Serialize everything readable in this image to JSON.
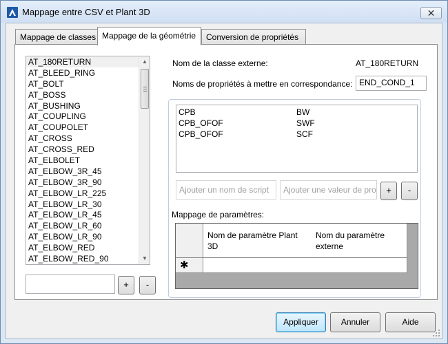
{
  "window": {
    "title": "Mappage entre CSV et Plant 3D",
    "close_glyph": "✕"
  },
  "tabs": [
    {
      "label": "Mappage de classes",
      "active": false
    },
    {
      "label": "Mappage de la géométrie",
      "active": true
    },
    {
      "label": "Conversion de propriétés",
      "active": false
    }
  ],
  "class_list": {
    "items": [
      "AT_180RETURN",
      "AT_BLEED_RING",
      "AT_BOLT",
      "AT_BOSS",
      "AT_BUSHING",
      "AT_COUPLING",
      "AT_COUPOLET",
      "AT_CROSS",
      "AT_CROSS_RED",
      "AT_ELBOLET",
      "AT_ELBOW_3R_45",
      "AT_ELBOW_3R_90",
      "AT_ELBOW_LR_225",
      "AT_ELBOW_LR_30",
      "AT_ELBOW_LR_45",
      "AT_ELBOW_LR_60",
      "AT_ELBOW_LR_90",
      "AT_ELBOW_RED",
      "AT_ELBOW_RED_90"
    ],
    "selected_index": 0,
    "new_class_value": "",
    "add_label": "+",
    "remove_label": "-"
  },
  "detail": {
    "external_class_label": "Nom de la classe externe:",
    "external_class_value": "AT_180RETURN",
    "props_to_map_label": "Noms de propriétés à mettre en correspondance:",
    "props_to_map_value": "END_COND_1"
  },
  "property_values": [
    {
      "name": "CPB",
      "value": "BW"
    },
    {
      "name": "CPB_OFOF",
      "value": "SWF"
    },
    {
      "name": "CPB_OFOF",
      "value": "SCF"
    }
  ],
  "script_name_placeholder": "Ajouter un nom de script",
  "prop_value_placeholder": "Ajouter une valeur de propriété",
  "add_value_label": "+",
  "remove_value_label": "-",
  "param_mapping": {
    "label": "Mappage de paramètres:",
    "columns": [
      "Nom de paramètre Plant 3D",
      "Nom du paramètre externe"
    ],
    "new_row_marker": "✱"
  },
  "buttons": {
    "apply": "Appliquer",
    "cancel": "Annuler",
    "help": "Aide"
  },
  "colors": {
    "accent": "#3c7fb1",
    "window_frame": "#dce7f4"
  }
}
